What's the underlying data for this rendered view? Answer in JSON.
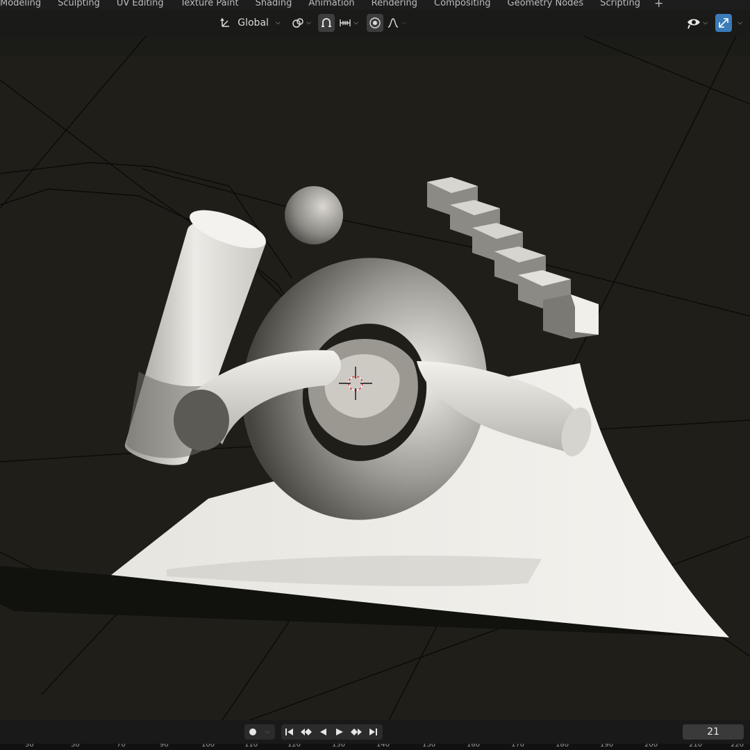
{
  "workspace_tabs": [
    "Modeling",
    "Sculpting",
    "UV Editing",
    "Texture Paint",
    "Shading",
    "Animation",
    "Rendering",
    "Compositing",
    "Geometry Nodes",
    "Scripting"
  ],
  "add_tab_label": "+",
  "header": {
    "transform_orientation": "Global",
    "icons": [
      "transform-orientation-icon",
      "pivot-point-icon",
      "snap-icon",
      "snap-increment-icon",
      "proportional-editing-icon",
      "falloff-curve-icon",
      "visibility-icon",
      "gizmo-icon"
    ]
  },
  "viewport": {
    "background_color": "#1f1e18",
    "object_color": "#e8e6e0",
    "cursor_color": "#e04040"
  },
  "timeline": {
    "current_frame": "21",
    "ruler_ticks": [
      "30",
      "50",
      "70",
      "90",
      "100",
      "110",
      "120",
      "130",
      "140",
      "150",
      "160",
      "170",
      "180",
      "190",
      "200",
      "210",
      "220"
    ]
  },
  "colors": {
    "accent_blue": "#3a7bb8"
  }
}
